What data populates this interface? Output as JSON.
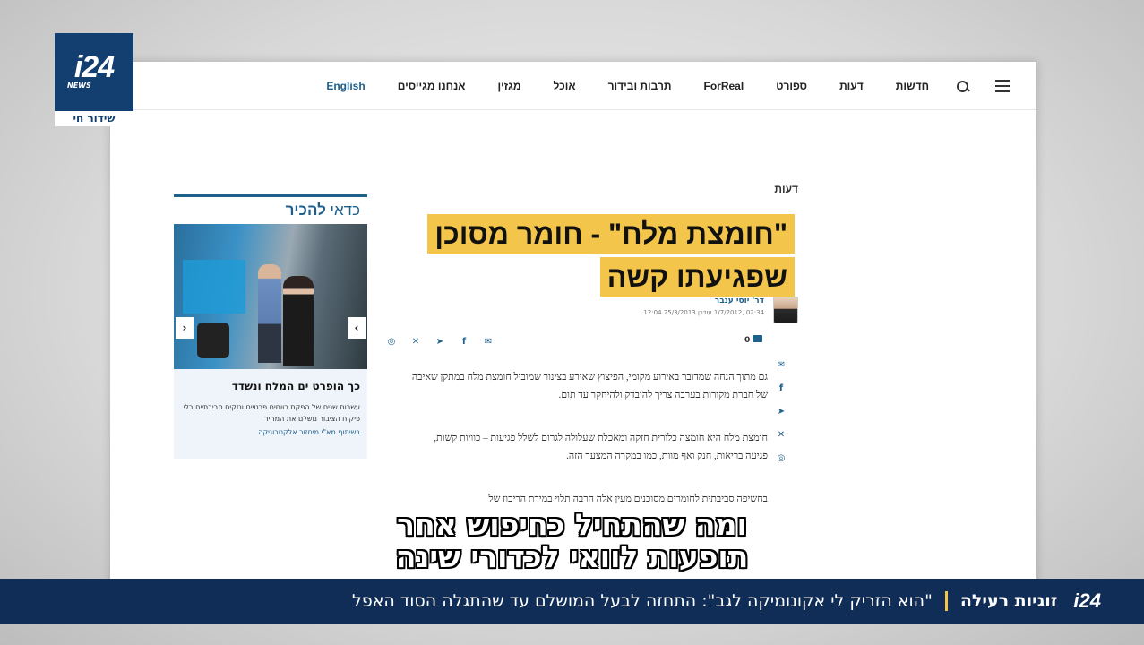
{
  "channel": {
    "logo": "i24",
    "logo_sub": "NEWS",
    "live_label": "שידור חי"
  },
  "website": {
    "nav": {
      "items": [
        "חדשות",
        "דעות",
        "ספורט",
        "ForReal",
        "תרבות ובידור",
        "אוכל",
        "מגזין",
        "אנחנו מגייסים",
        "English"
      ]
    },
    "article": {
      "section": "דעות",
      "headline_line1": "\"חומצת מלח\" - חומר מסוכן",
      "headline_line2": "שפגיעתו קשה",
      "author": "דר' יוסי ענבר",
      "date": "02:34 ,1/7/2012 עודכן 25/3/2013 12:04",
      "comments_count": "0",
      "paragraphs": [
        "גם מתוך הנחה שמדובר באירוע מקומי, הפיצוץ שאירע בצינור שמוביל חומצת מלח במתקן שאיבה של חברת מקורות בערבה צריך להיבדק ולהיחקר עד תום.",
        "חומצת מלח היא חומצה כלורית חזקה ומאכלת שעלולה לגרום לשלל פגיעות – כוויות קשות, פגיעה בריאות, חנק ואף מוות, כמו במקרה המצער הזה.",
        "בחשיפה סביבתית לחומרים מסוכנים מעין אלה הרבה תלוי במידת הריכוז של"
      ]
    },
    "sidebar": {
      "title_plain": "כדאי ",
      "title_bold": "להכיר",
      "arrow_left": "‹",
      "arrow_right": "›",
      "caption_title": "כך הופרט ים המלח ונשדד",
      "caption_desc": "עשרות שנים של הפקת רווחים פרטיים ונזקים סביבתיים בלי פיקוח הציבור משלם את המחיר",
      "sponsor": "בשיתוף מא\"י מיחזור אלקטרוניקה"
    }
  },
  "subtitle": {
    "line1": "ומה שהתחיל כחיפוש אחר",
    "line2": "תופעות לוואי לכדורי שינה"
  },
  "ticker": {
    "logo": "i24",
    "tag": "זוגיות רעילה",
    "headline": "\"הוא הזריק לי אקונומיקה לגב\": התחזה לבעל המושלם עד שהתגלה הסוד האפל"
  }
}
